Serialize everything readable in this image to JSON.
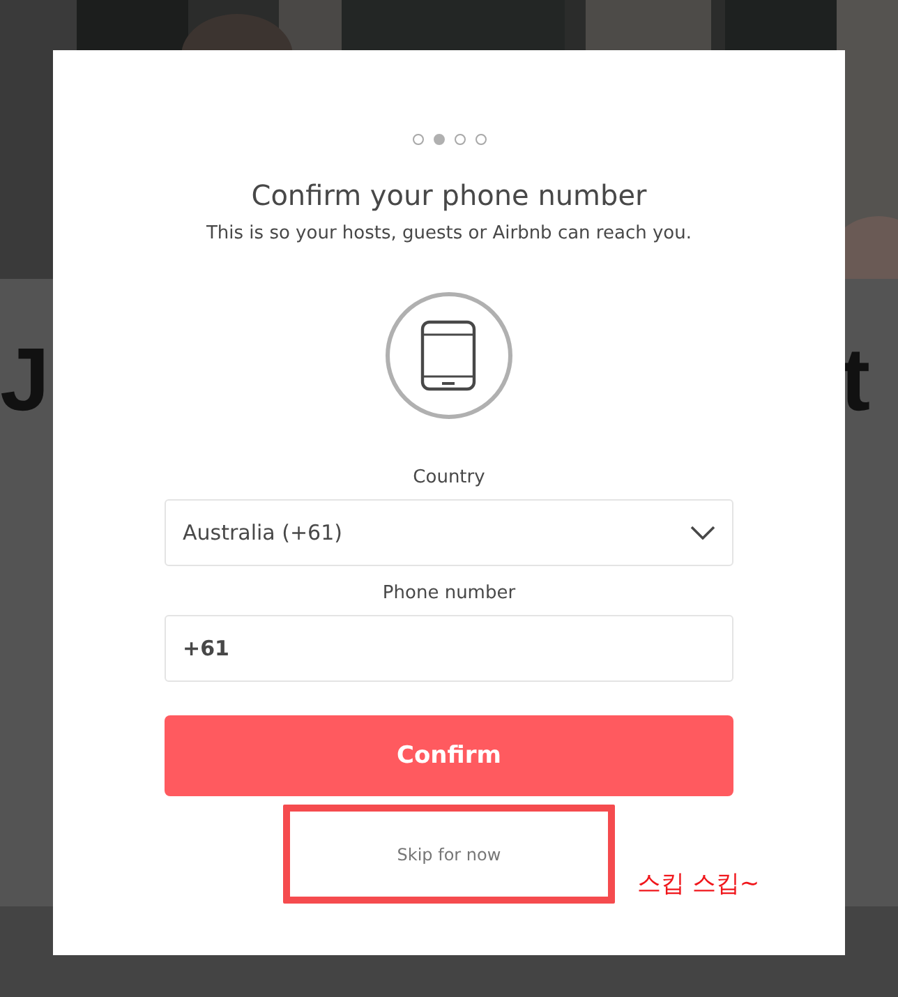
{
  "background": {
    "kind": "picture",
    "heading_left": "J",
    "heading_right": "t"
  },
  "dialog": {
    "steps": [
      {
        "selected": false
      },
      {
        "selected": true
      },
      {
        "selected": false
      },
      {
        "selected": false
      }
    ],
    "title": "Confirm your phone number",
    "subtitle": "This is so your hosts, guests or Airbnb can reach you.",
    "country": {
      "label": "Country",
      "value": "Australia (+61)"
    },
    "phone": {
      "label": "Phone number",
      "value": "+61"
    },
    "confirm_button": "Confirm",
    "skip_button": "Skip for now"
  },
  "annotation": {
    "highlighted": true,
    "note": "스킵 스킵~"
  }
}
